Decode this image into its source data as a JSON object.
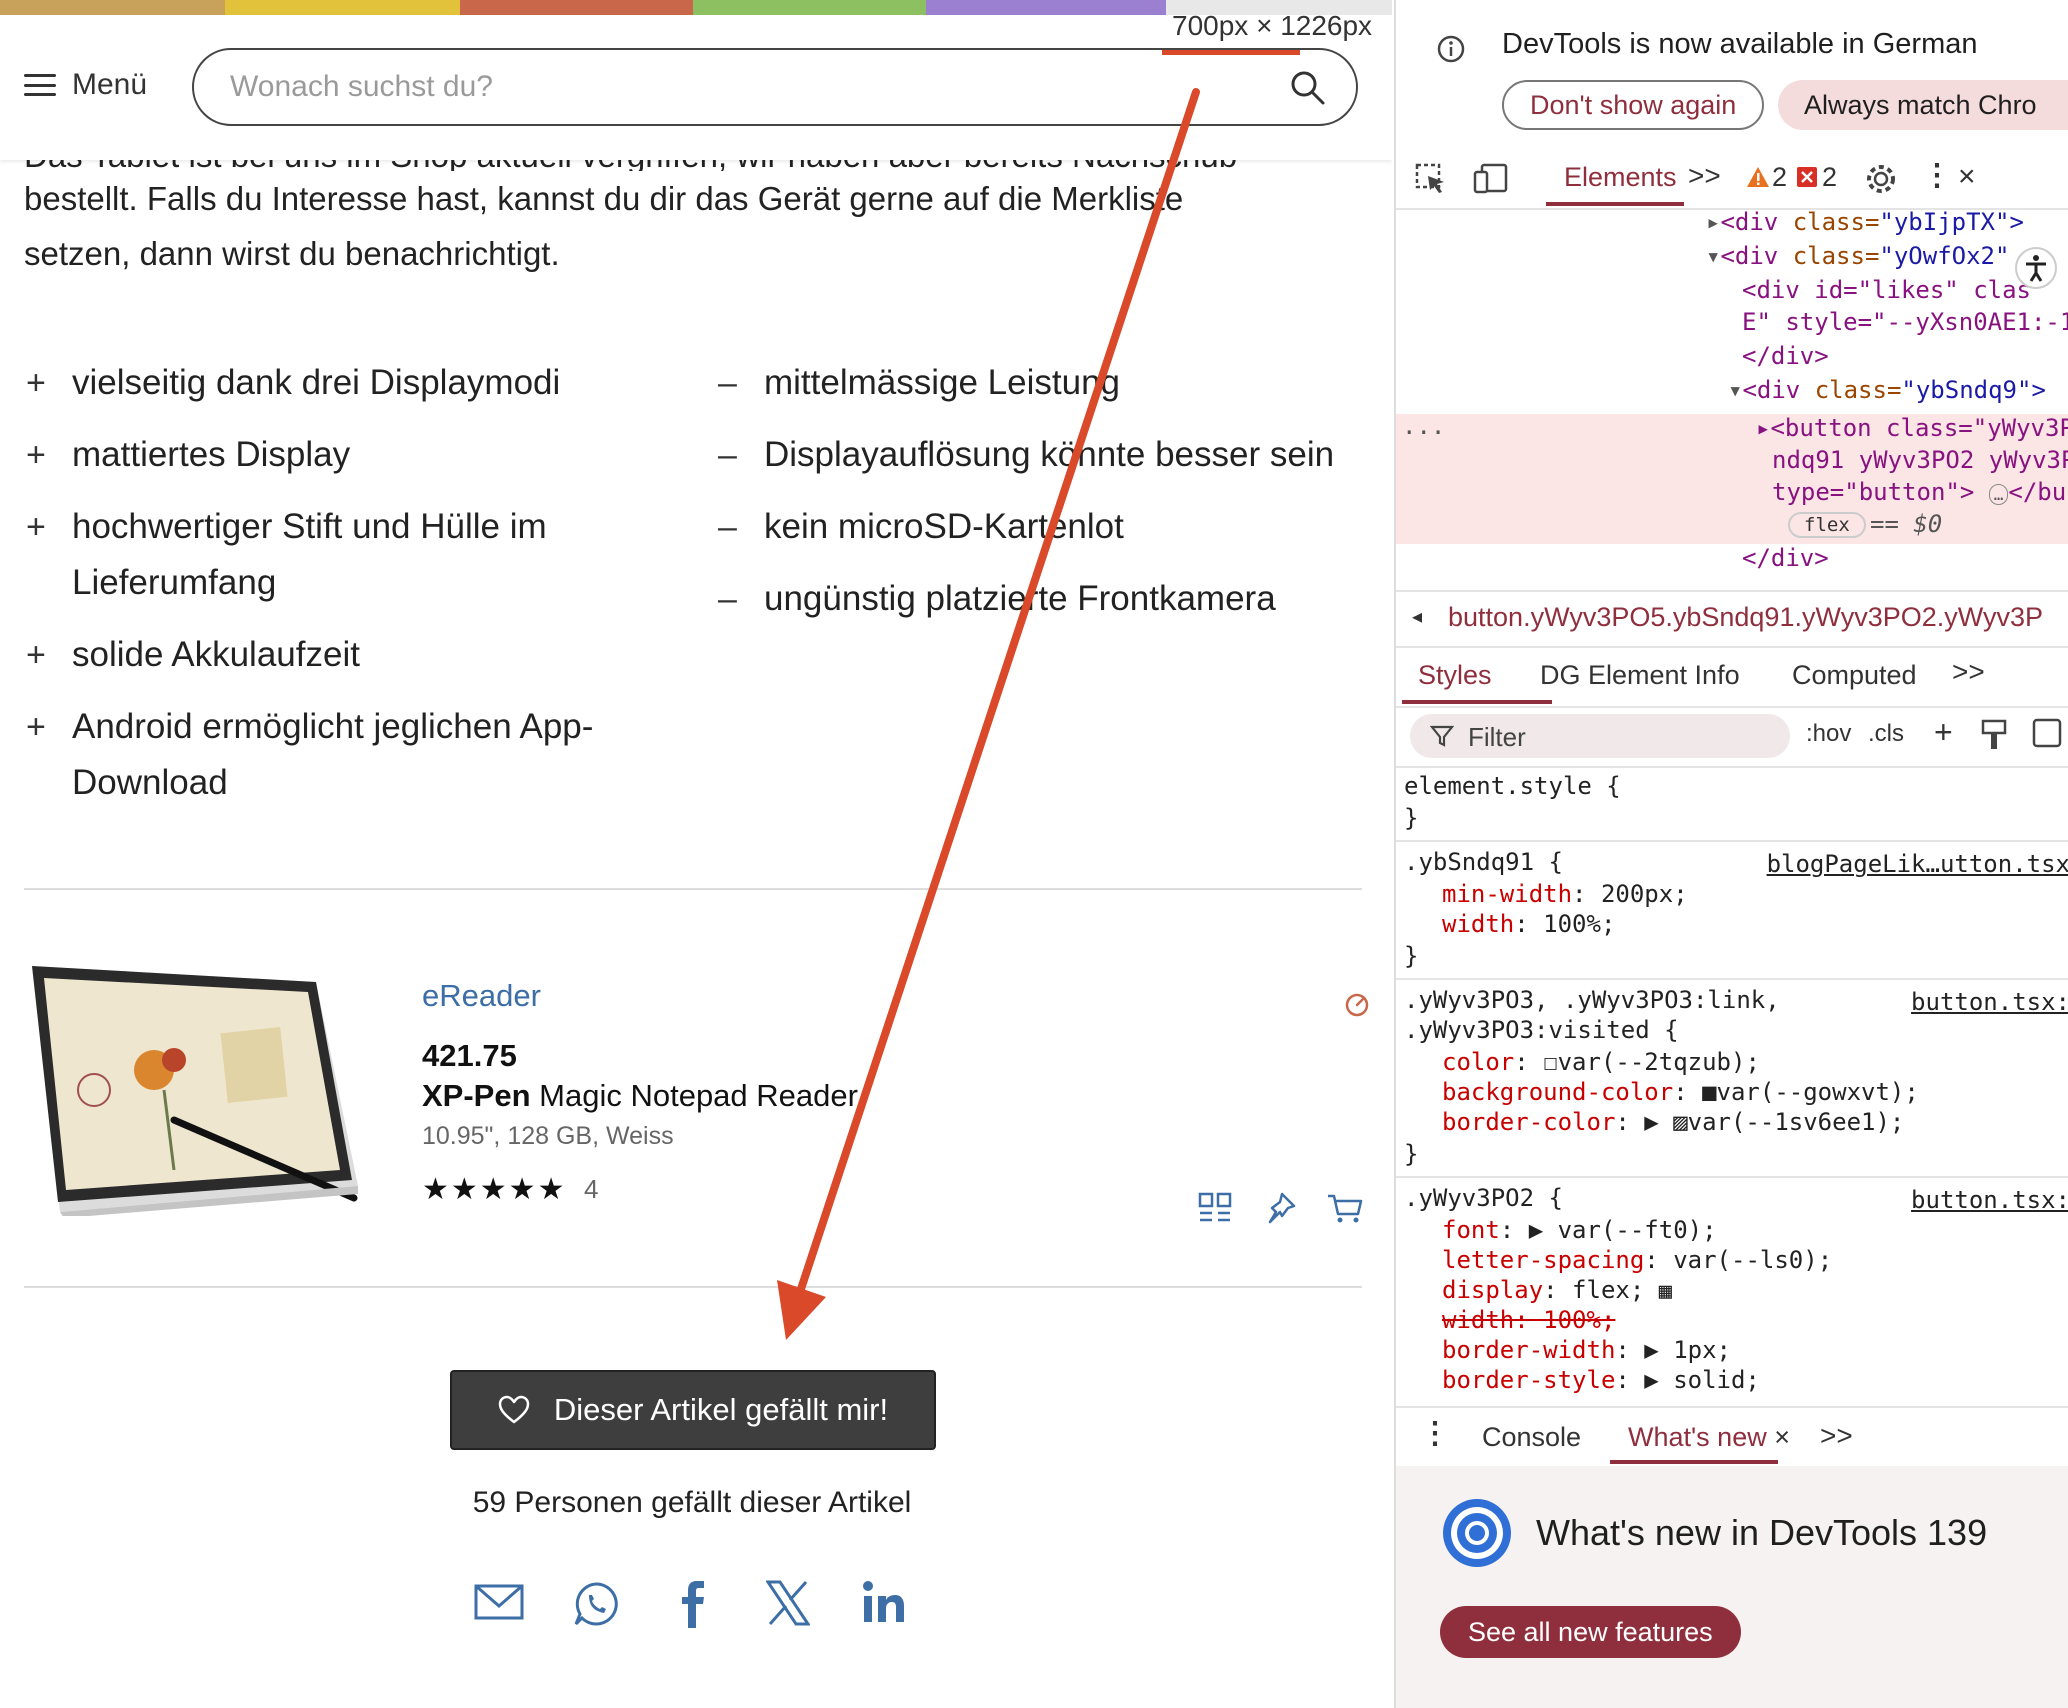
{
  "page": {
    "dimensions_label": "700px × 1226px",
    "menu_label": "Menü",
    "search_placeholder": "Wonach suchst du?",
    "intro_line1": "Das Tablet ist bei uns im Shop aktuell vergriffen, wir haben aber bereits Nachschub",
    "intro_line2": "bestellt. Falls du Interesse hast, kannst du dir das Gerät gerne auf die Merkliste",
    "intro_line3": "setzen, dann wirst du benachrichtigt.",
    "pros": [
      {
        "sign": "+",
        "line1": "vielseitig dank drei Displaymodi",
        "line2": ""
      },
      {
        "sign": "+",
        "line1": "mattiertes Display",
        "line2": ""
      },
      {
        "sign": "+",
        "line1": "hochwertiger Stift und Hülle im",
        "line2": "Lieferumfang"
      },
      {
        "sign": "+",
        "line1": "solide Akkulaufzeit",
        "line2": ""
      },
      {
        "sign": "+",
        "line1": "Android ermöglicht jeglichen App-",
        "line2": "Download"
      }
    ],
    "cons": [
      {
        "sign": "–",
        "text": "mittelmässige Leistung"
      },
      {
        "sign": "–",
        "text": "Displayauflösung könnte besser sein"
      },
      {
        "sign": "–",
        "text": "kein microSD-Kartenlot"
      },
      {
        "sign": "–",
        "text": "ungünstig platzierte Frontkamera"
      }
    ],
    "product": {
      "category": "eReader",
      "price": "421.75",
      "brand": "XP-Pen",
      "name": "Magic Notepad Reader",
      "specs": "10.95\", 128 GB, Weiss",
      "stars": "★★★★★",
      "rating": 5,
      "review_count": "4"
    },
    "like_button": "Dieser Artikel gefällt mir!",
    "like_count_text": "59 Personen gefällt dieser Artikel",
    "share_icons": [
      "mail-icon",
      "whatsapp-icon",
      "facebook-icon",
      "x-icon",
      "linkedin-icon"
    ],
    "stripe_colors": [
      "#c8a25a",
      "#e2c23a",
      "#c8674a",
      "#8cc061",
      "#9b7fd0",
      "#cfcfcf"
    ],
    "accent_color": "#3d6ea5",
    "annotation_color": "#d9492a"
  },
  "devtools": {
    "banner_text": "DevTools is now available in German",
    "dont_show": "Don't show again",
    "always_match": "Always match Chro",
    "tab_elements": "Elements",
    "more_tabs": ">>",
    "warnings": "2",
    "errors": "2",
    "dom_lines": {
      "l1_tag": "<div ",
      "l1_attr": "class=",
      "l1_val": "\"ybIjpTX\">",
      "l2_tag": "<div ",
      "l2_attr": "class=",
      "l2_val": "\"yOwfOx2\"",
      "l3": "<div id=\"likes\" clas",
      "l4": "E\" style=\"--yXsn0AE1:-1",
      "l5": "</div>",
      "l6_tag": "<div ",
      "l6_attr": "class=",
      "l6_val": "\"ybSndq9\">",
      "l7": "<button class=\"yWyv3P",
      "l8": "ndq91 yWyv3PO2 yWyv3P",
      "l9": "type=\"button\">",
      "l9b": "</bu",
      "flex_badge": "flex",
      "eq_dollar": "== $0",
      "l10": "</div>",
      "ellipsis": "..."
    },
    "breadcrumb": "button.yWyv3PO5.ybSndq91.yWyv3PO2.yWyv3P",
    "subtabs": [
      "Styles",
      "DG Element Info",
      "Computed"
    ],
    "filter_placeholder": "Filter",
    "hov": ":hov",
    "cls": ".cls",
    "styles": {
      "r0_sel": "element.style {",
      "r0_close": "}",
      "r1_sel": ".ybSndq91 {",
      "r1_src": "blogPageLik…utton.tsx",
      "r1_p1": "min-width",
      "r1_v1": ": 200px;",
      "r1_p2": "width",
      "r1_v2": ": 100%;",
      "r1_close": "}",
      "r2_sel1": ".yWyv3PO3, .yWyv3PO3:link,",
      "r2_sel2": ".yWyv3PO3:visited {",
      "r2_src": "button.tsx:",
      "r2_p1": "color",
      "r2_v1": ": ☐var(--2tqzub);",
      "r2_p2": "background-color",
      "r2_v2": ": ■var(--gowxvt);",
      "r2_p3": "border-color",
      "r2_v3": ": ▶ ▨var(--1sv6ee1);",
      "r2_close": "}",
      "r3_sel": ".yWyv3PO2 {",
      "r3_src": "button.tsx:",
      "r3_p1": "font",
      "r3_v1": ": ▶ var(--ft0);",
      "r3_p2": "letter-spacing",
      "r3_v2": ": var(--ls0);",
      "r3_p3": "display",
      "r3_v3": ": flex;",
      "r3_p4": "width: 100%;",
      "r3_p5": "border-width",
      "r3_v5": ": ▶ 1px;",
      "r3_p6": "border-style",
      "r3_v6": ": ▶ solid;"
    },
    "drawer_console": "Console",
    "drawer_whatsnew": "What's new",
    "whatsnew_title": "What's new in DevTools 139",
    "see_all": "See all new features"
  }
}
